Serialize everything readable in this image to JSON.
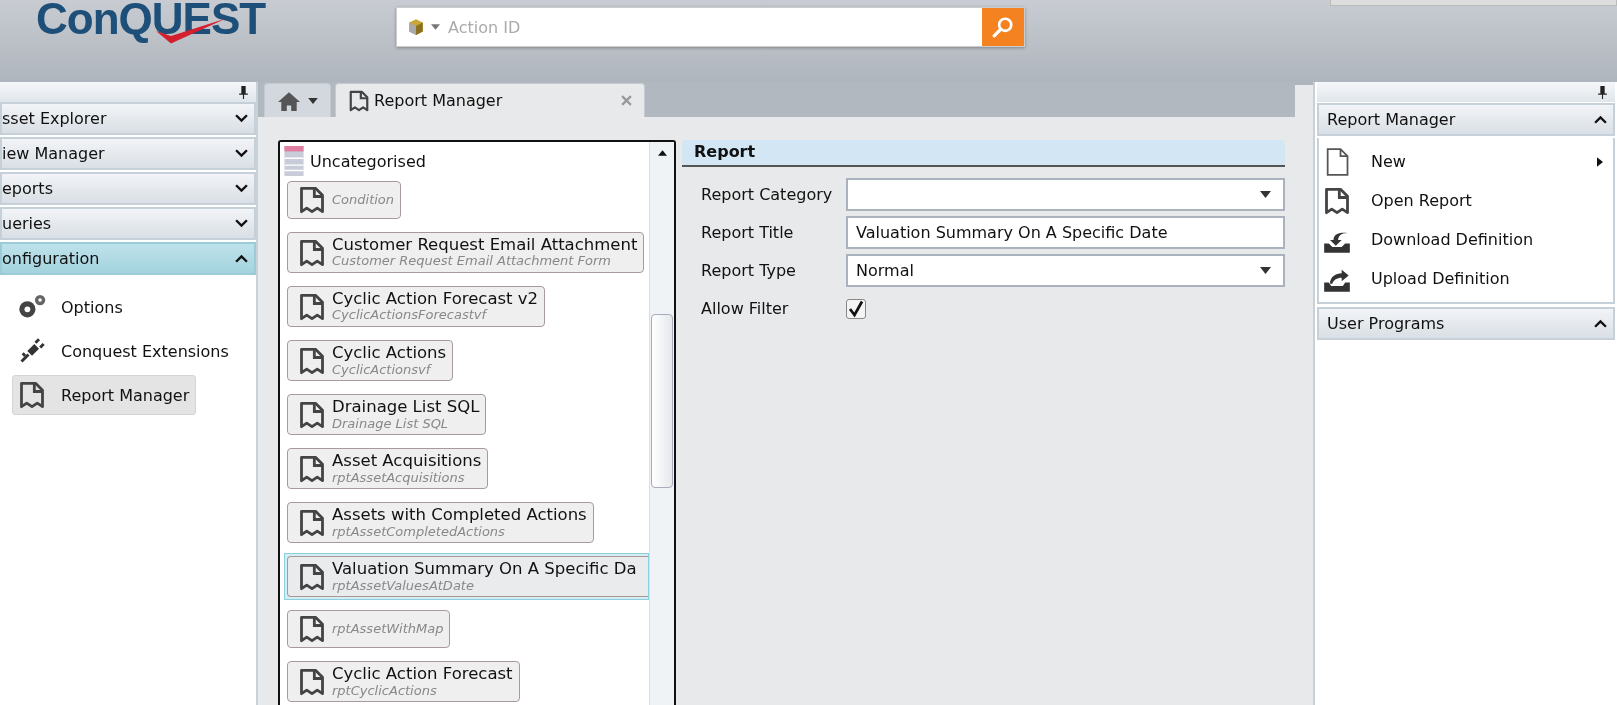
{
  "header": {
    "logo": "ConQUEST",
    "search": {
      "placeholder": "Action ID"
    }
  },
  "left_panel": {
    "sections": [
      {
        "label": "sset Explorer",
        "expanded": false
      },
      {
        "label": "iew Manager",
        "expanded": false
      },
      {
        "label": "eports",
        "expanded": false
      },
      {
        "label": "ueries",
        "expanded": false
      },
      {
        "label": "onfiguration",
        "expanded": true,
        "children": [
          {
            "kind": "gears",
            "label": "Options",
            "selected": false
          },
          {
            "kind": "plug",
            "label": "Conquest Extensions",
            "selected": false
          },
          {
            "kind": "report",
            "label": "Report Manager",
            "selected": true
          }
        ]
      }
    ]
  },
  "tabs": [
    {
      "kind": "home",
      "selected": false
    },
    {
      "kind": "doc",
      "label": "Report Manager",
      "selected": true,
      "closable": true
    }
  ],
  "report_list": {
    "category": "Uncategorised",
    "items": [
      {
        "name": "Condition",
        "selected": false
      },
      {
        "title": "Customer Request Email Attachment",
        "name": "Customer Request Email Attachment Form",
        "selected": false
      },
      {
        "title": "Cyclic Action Forecast v2",
        "name": "CyclicActionsForecastvf",
        "selected": false
      },
      {
        "title": "Cyclic Actions",
        "name": "CyclicActionsvf",
        "selected": false
      },
      {
        "title": "Drainage List SQL",
        "name": "Drainage List SQL",
        "selected": false
      },
      {
        "title": "Asset Acquisitions",
        "name": "rptAssetAcquisitions",
        "selected": false
      },
      {
        "title": "Assets with Completed Actions",
        "name": "rptAssetCompletedActions",
        "selected": false
      },
      {
        "title": "Valuation Summary On A Specific Da",
        "name": "rptAssetValuesAtDate",
        "selected": true
      },
      {
        "name": "rptAssetWithMap",
        "selected": false
      },
      {
        "title": "Cyclic Action Forecast",
        "name": "rptCyclicActions",
        "selected": false
      }
    ]
  },
  "form": {
    "title": "Report",
    "fields": [
      {
        "kind": "dropdown",
        "label": "Report Category"
      },
      {
        "kind": "text",
        "label": "Report Title",
        "value": "Valuation Summary On A Specific Date"
      },
      {
        "kind": "dropdown",
        "label": "Report Type",
        "value": "Normal"
      },
      {
        "kind": "checkbox",
        "label": "Allow Filter",
        "checked": true
      }
    ]
  },
  "right_panel": {
    "sections": [
      {
        "label": "Report Manager",
        "expanded": true,
        "items": [
          {
            "kind": "new",
            "label": "New",
            "submenu": true
          },
          {
            "kind": "open",
            "label": "Open Report",
            "submenu": false
          },
          {
            "kind": "download",
            "label": "Download Definition",
            "submenu": false
          },
          {
            "kind": "upload",
            "label": "Upload Definition",
            "submenu": false
          }
        ]
      },
      {
        "label": "User Programs",
        "expanded": true
      }
    ]
  }
}
